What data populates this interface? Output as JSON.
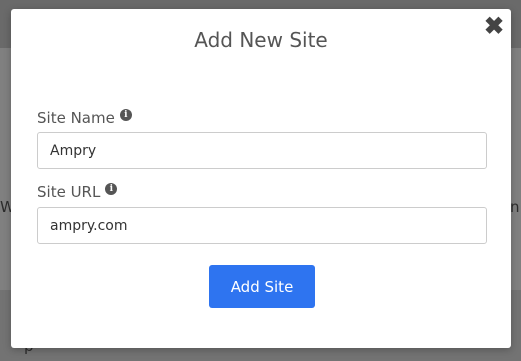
{
  "background": {
    "left_text": "Wi",
    "right_text": "n",
    "bottom_text": "p"
  },
  "modal": {
    "title": "Add New Site",
    "close_glyph": "✖",
    "site_name": {
      "label": "Site Name",
      "value": "Ampry",
      "info_glyph": "i"
    },
    "site_url": {
      "label": "Site URL",
      "value": "ampry.com",
      "info_glyph": "i"
    },
    "submit_label": "Add Site"
  },
  "colors": {
    "primary_button": "#2e74f0",
    "overlay": "#808080"
  }
}
